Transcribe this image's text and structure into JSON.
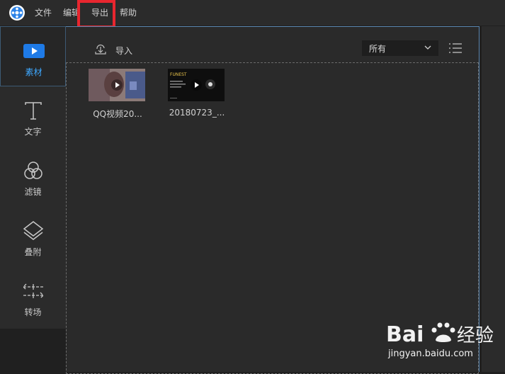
{
  "menu": {
    "items": [
      {
        "label": "文件"
      },
      {
        "label": "编辑"
      },
      {
        "label": "导出"
      },
      {
        "label": "帮助"
      }
    ],
    "highlighted": "导出",
    "highlight_color": "#e8262f"
  },
  "sidebar": {
    "items": [
      {
        "label": "素材",
        "icon": "media-icon",
        "active": true
      },
      {
        "label": "文字",
        "icon": "text-icon"
      },
      {
        "label": "滤镜",
        "icon": "filter-icon"
      },
      {
        "label": "叠附",
        "icon": "overlay-icon"
      },
      {
        "label": "转场",
        "icon": "transition-icon"
      }
    ]
  },
  "toolbar": {
    "import_label": "导入",
    "filter_value": "所有"
  },
  "media": [
    {
      "name": "QQ视频20..."
    },
    {
      "name": "20180723_..."
    }
  ],
  "thumb2_text": "FUNEST",
  "watermark": {
    "brand": "Bai 经验",
    "url": "jingyan.baidu.com"
  },
  "colors": {
    "accent": "#1e7ae6",
    "active_label": "#3ea8ff",
    "panel": "#2a2a2a"
  }
}
